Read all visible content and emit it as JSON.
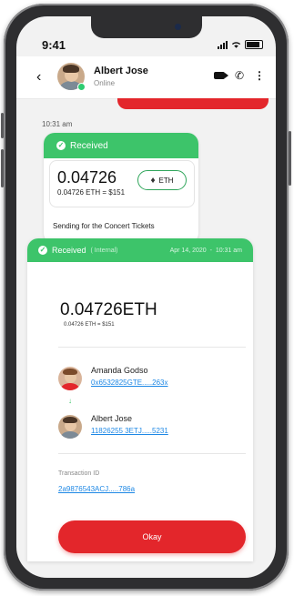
{
  "status_bar": {
    "time": "9:41"
  },
  "chat_header": {
    "name": "Albert Jose",
    "status": "Online"
  },
  "messages": {
    "time": "10:31 am",
    "received_card": {
      "status": "Received",
      "amount": "0.04726",
      "conversion": "0.04726 ETH = $151",
      "currency": "ETH",
      "note": "Sending for the Concert Tickets"
    }
  },
  "detail": {
    "status": "Received",
    "type": "( Internal)",
    "date": "Apr 14, 2020",
    "time": "10:31 am",
    "amount": "0.04726ETH",
    "conversion": "0.04726 ETH = $151",
    "from": {
      "name": "Amanda Godso",
      "address": "0x6532825GTE.....263x"
    },
    "to": {
      "name": "Albert Jose",
      "address": "11826255 3ETJ.....5231"
    },
    "transaction_label": "Transaction ID",
    "transaction_id": "2a9876543ACJ.....786a",
    "okay_button": "Okay"
  },
  "colors": {
    "accent_red": "#e3262b",
    "success_green": "#3dc46a",
    "link_blue": "#1e88e5"
  },
  "icons": [
    "back-icon",
    "video-call-icon",
    "phone-call-icon",
    "more-icon",
    "check-icon",
    "eth-icon",
    "arrow-down-icon"
  ]
}
